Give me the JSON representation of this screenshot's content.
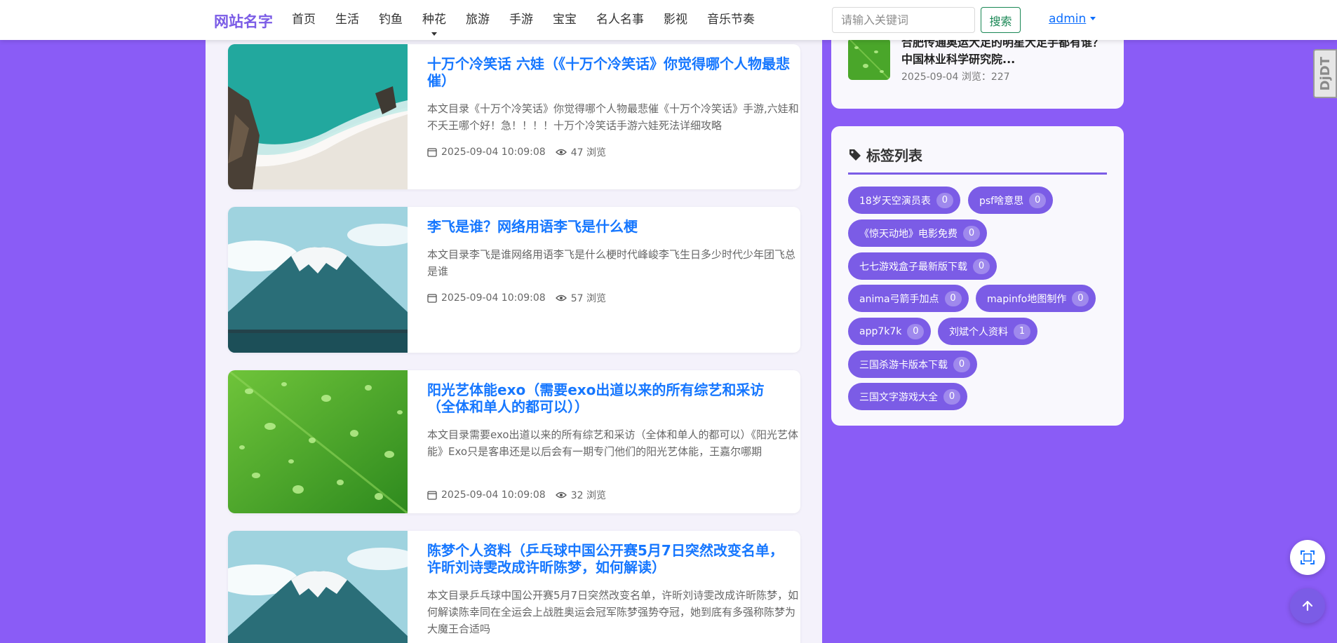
{
  "header": {
    "logo": "网站名字",
    "nav": [
      "首页",
      "生活",
      "钓鱼",
      "种花",
      "旅游",
      "手游",
      "宝宝",
      "名人名事",
      "影视",
      "音乐节奏"
    ],
    "search_placeholder": "请输入关键词",
    "search_button": "搜索",
    "user": "admin"
  },
  "articles": [
    {
      "title": "十万个冷笑话 六娃（《十万个冷笑话》你觉得哪个人物最悲催）",
      "excerpt": "本文目录《十万个冷笑话》你觉得哪个人物最悲催《十万个冷笑话》手游,六娃和不夭王哪个好！急！！！！十万个冷笑话手游六娃死法详细攻略",
      "date": "2025-09-04 10:09:08",
      "views": "47 浏览",
      "image": "beach-aerial"
    },
    {
      "title": "李飞是谁？网络用语李飞是什么梗",
      "excerpt": "本文目录李飞是谁网络用语李飞是什么梗时代峰峻李飞生日多少时代少年团飞总是谁",
      "date": "2025-09-04 10:09:08",
      "views": "57 浏览",
      "image": "mount-fuji"
    },
    {
      "title": "阳光艺体能exo（需要exo出道以来的所有综艺和采访（全体和单人的都可以））",
      "excerpt": "本文目录需要exo出道以来的所有综艺和采访（全体和单人的都可以）《阳光艺体能》Exo只是客串还是以后会有一期专门他们的阳光艺体能，王嘉尔哪期",
      "date": "2025-09-04 10:09:08",
      "views": "32 浏览",
      "image": "green-leaf"
    },
    {
      "title": "陈梦个人资料（乒乓球中国公开赛5月7日突然改变名单，许昕刘诗雯改成许昕陈梦，如何解读）",
      "excerpt": "本文目录乒乓球中国公开赛5月7日突然改变名单，许昕刘诗雯改成许昕陈梦，如何解读陈幸同在全运会上战胜奥运会冠军陈梦强势夺冠，她到底有多强称陈梦为大魔王合适吗",
      "date": "",
      "views": "",
      "image": "mount-fuji"
    }
  ],
  "hot": {
    "title": "合肥传通奥运大足的明星大足手都有谁？中国林业科学研究院...",
    "date": "2025-09-04",
    "views": "浏览：227"
  },
  "tags": {
    "title": "标签列表",
    "items": [
      {
        "label": "18岁天空演员表",
        "count": "0"
      },
      {
        "label": "psf啥意思",
        "count": "0"
      },
      {
        "label": "《惊天动地》电影免费",
        "count": "0"
      },
      {
        "label": "七七游戏盒子最新版下载",
        "count": "0"
      },
      {
        "label": "anima弓箭手加点",
        "count": "0"
      },
      {
        "label": "mapinfo地图制作",
        "count": "0"
      },
      {
        "label": "app7k7k",
        "count": "0"
      },
      {
        "label": "刘斌个人资料",
        "count": "1"
      },
      {
        "label": "三国杀游卡版本下载",
        "count": "0"
      },
      {
        "label": "三国文字游戏大全",
        "count": "0"
      }
    ]
  },
  "badge": "DjDT",
  "colors": {
    "accent": "#7b5ce6",
    "link": "#1677ff",
    "background": "#8a5cf6"
  }
}
